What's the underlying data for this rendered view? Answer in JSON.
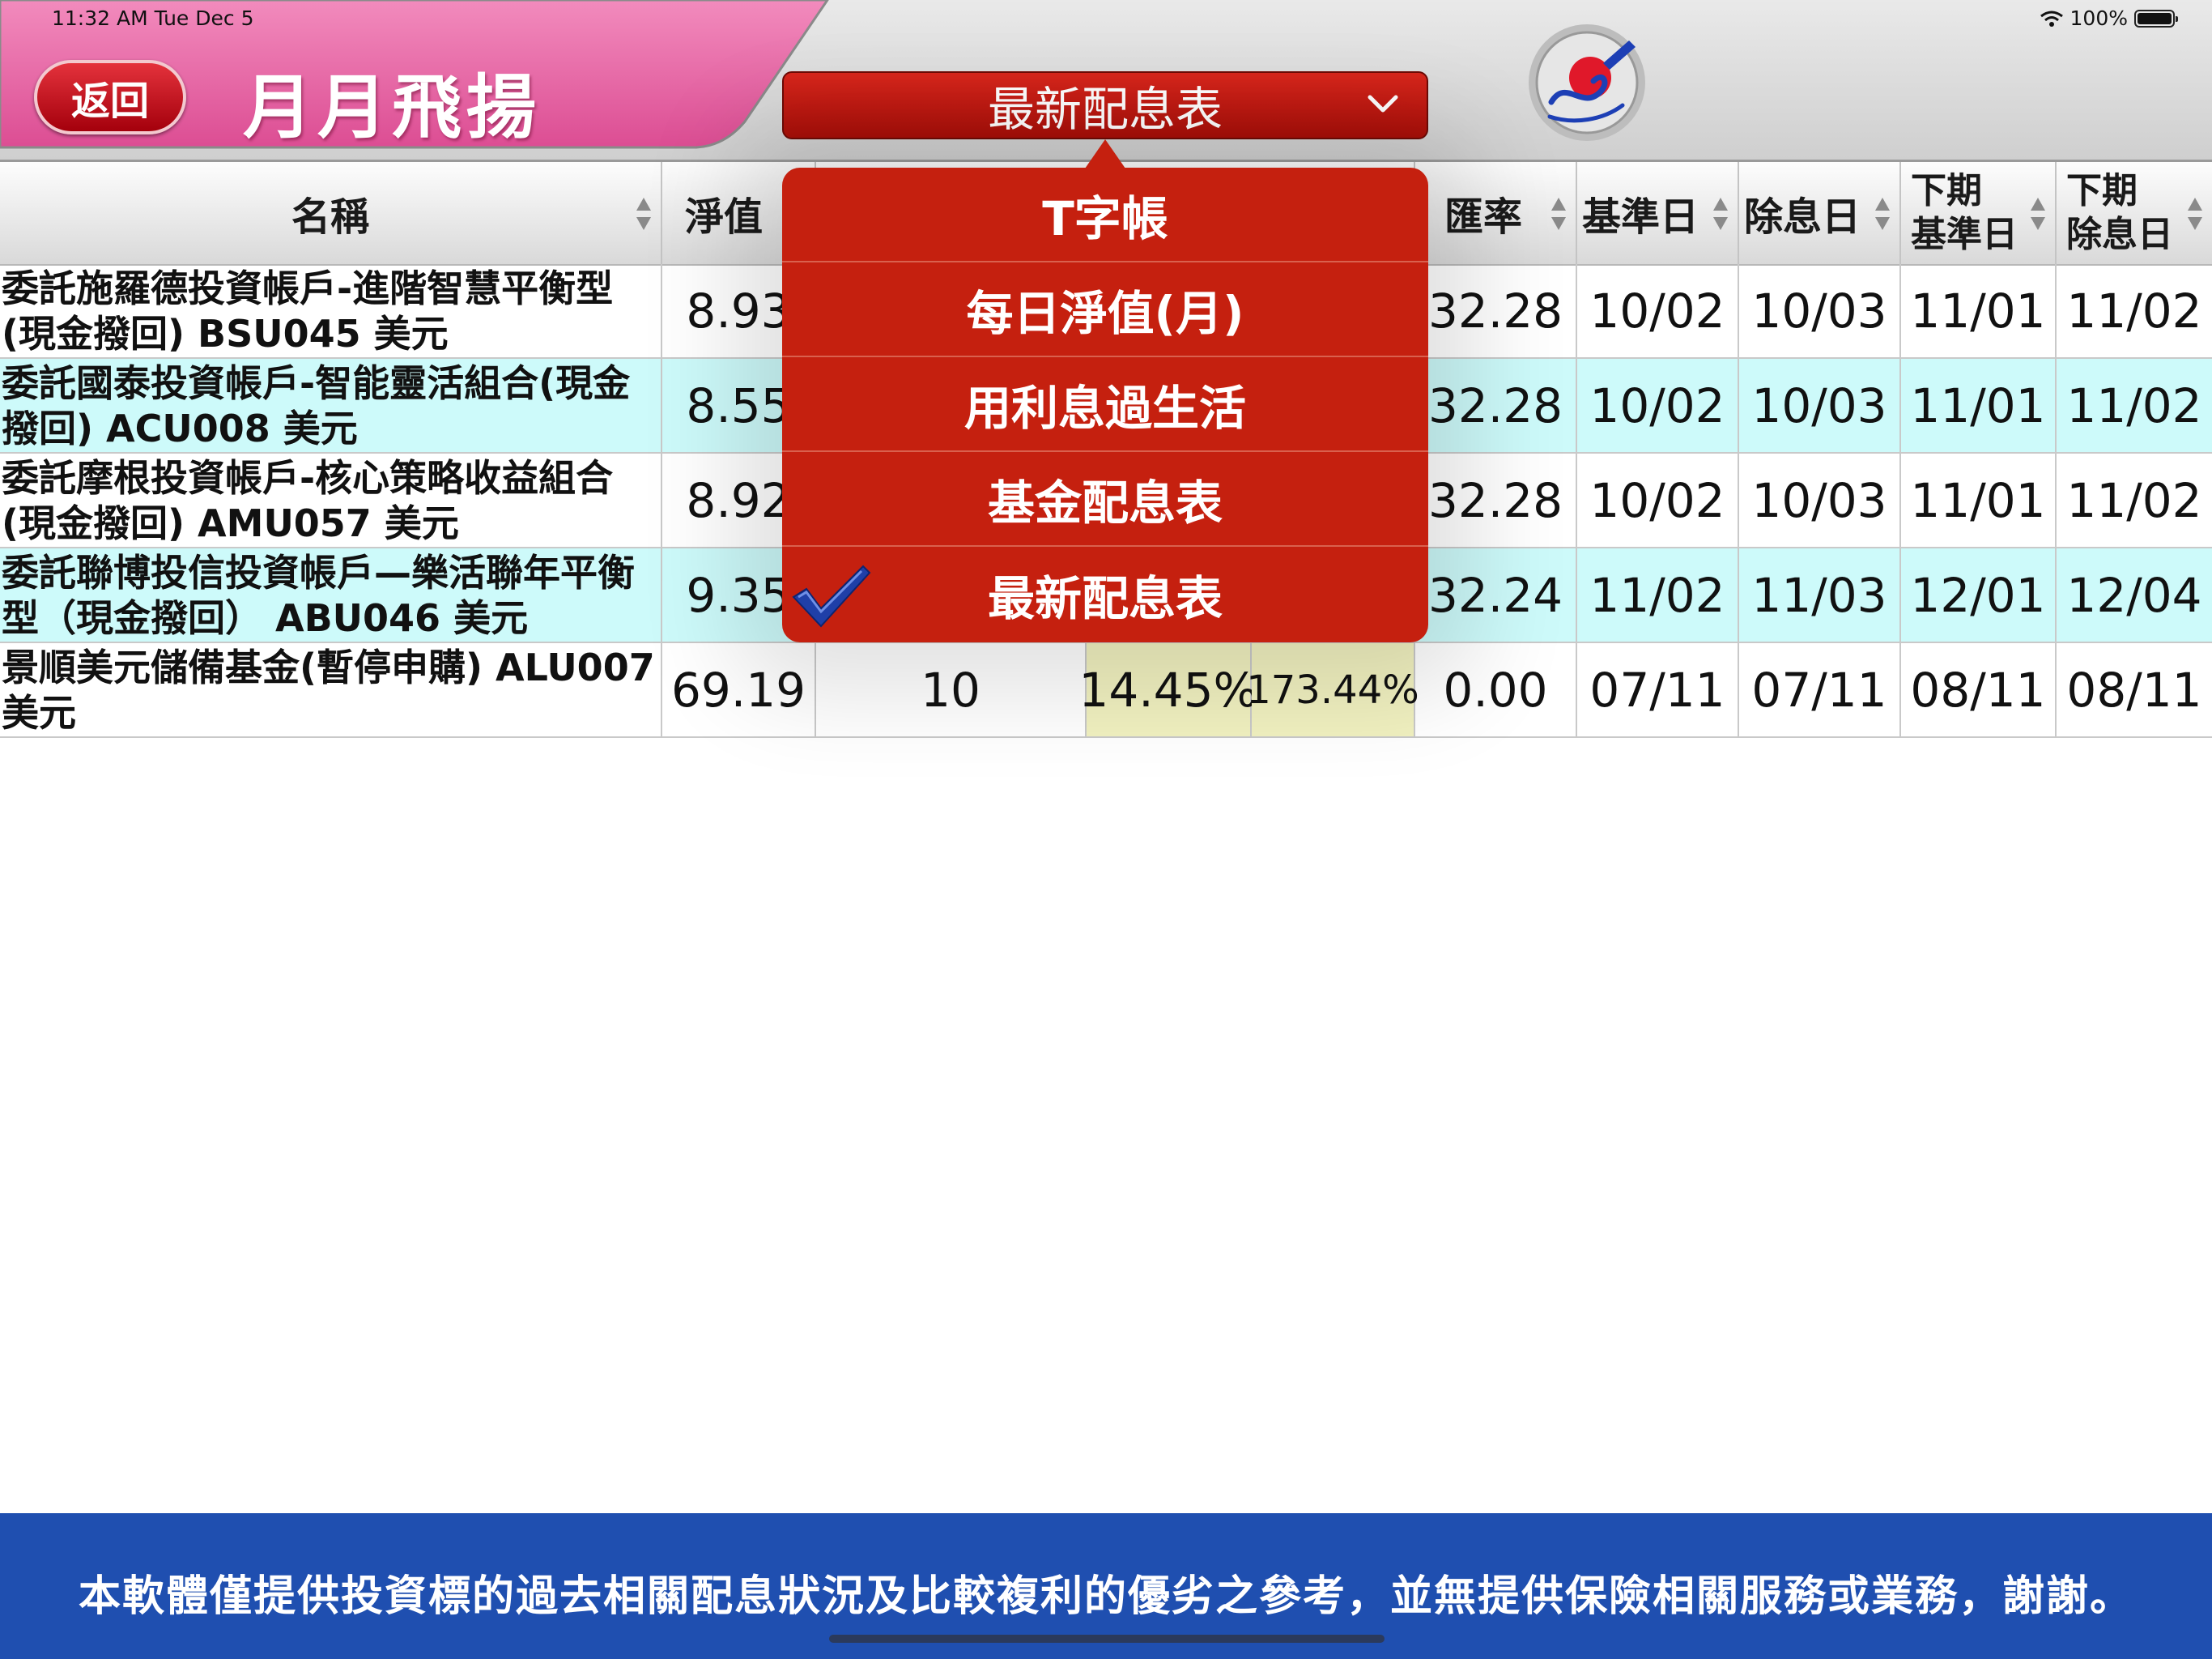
{
  "status_bar": {
    "time": "11:32 AM   Tue Dec 5",
    "battery": "100%"
  },
  "header": {
    "back_label": "返回",
    "title": "月月飛揚",
    "dropdown_selected": "最新配息表",
    "colors": {
      "banner": "#e8629f",
      "accent_red": "#c5200f"
    }
  },
  "table": {
    "headers": {
      "name": "名稱",
      "nav": "淨值",
      "rate": "匯率",
      "base_date": "基準日",
      "ex_date": "除息日",
      "next_base_line1": "下期",
      "next_base_line2": "基準日",
      "next_ex_line1": "下期",
      "next_ex_line2": "除息日"
    },
    "rows": [
      {
        "name": "委託施羅德投資帳戶-進階智慧平衡型(現金撥回) BSU045 美元",
        "nav": "8.93",
        "rate": "32.28",
        "base_date": "10/02",
        "ex_date": "10/03",
        "next_base": "11/01",
        "next_ex": "11/02"
      },
      {
        "name": "委託國泰投資帳戶-智能靈活組合(現金撥回) ACU008 美元",
        "nav": "8.55",
        "rate": "32.28",
        "base_date": "10/02",
        "ex_date": "10/03",
        "next_base": "11/01",
        "next_ex": "11/02"
      },
      {
        "name": "委託摩根投資帳戶-核心策略收益組合(現金撥回) AMU057 美元",
        "nav": "8.92",
        "rate": "32.28",
        "base_date": "10/02",
        "ex_date": "10/03",
        "next_base": "11/01",
        "next_ex": "11/02"
      },
      {
        "name": "委託聯博投信投資帳戶—樂活聯年平衡型（現金撥回） ABU046 美元",
        "nav": "9.35",
        "rate": "32.24",
        "base_date": "11/02",
        "ex_date": "11/03",
        "next_base": "12/01",
        "next_ex": "12/04"
      },
      {
        "name": "景順美元儲備基金(暫停申購) ALU007 美元",
        "nav": "69.19",
        "col3": "10",
        "col4": "14.45%",
        "col5": "173.44%",
        "rate": "0.00",
        "base_date": "07/11",
        "ex_date": "07/11",
        "next_base": "08/11",
        "next_ex": "08/11"
      }
    ]
  },
  "menu": {
    "items": [
      "T字帳",
      "每日淨值(月)",
      "用利息過生活",
      "基金配息表",
      "最新配息表"
    ],
    "selected_index": 4
  },
  "footer": {
    "text": "本軟體僅提供投資標的過去相關配息狀況及比較複利的優劣之參考，並無提供保險相關服務或業務，謝謝。",
    "color": "#1f4fb0"
  }
}
